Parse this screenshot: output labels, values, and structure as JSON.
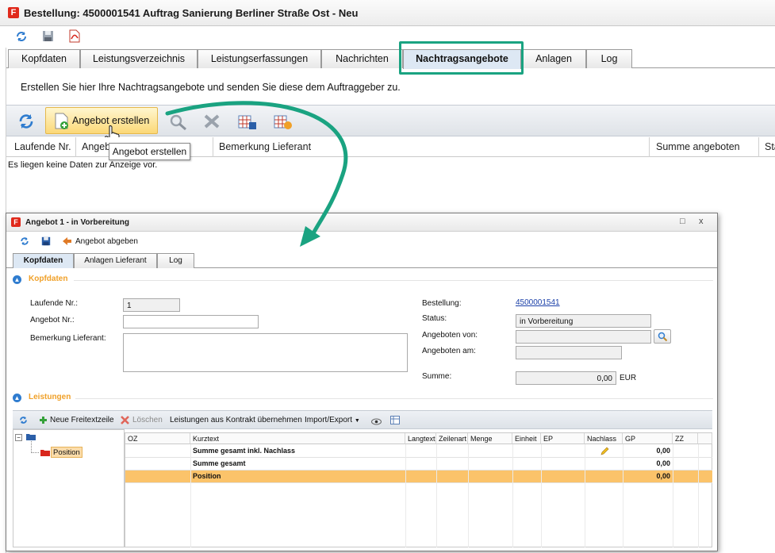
{
  "window": {
    "title": "Bestellung: 4500001541 Auftrag Sanierung Berliner Straße Ost - Neu",
    "logo_letter": "F"
  },
  "toolbar": {
    "icons": [
      "refresh-icon",
      "save-icon",
      "pdf-icon"
    ]
  },
  "tabs": [
    {
      "label": "Kopfdaten"
    },
    {
      "label": "Leistungsverzeichnis"
    },
    {
      "label": "Leistungserfassungen"
    },
    {
      "label": "Nachrichten"
    },
    {
      "label": "Nachtragsangebote",
      "active": true
    },
    {
      "label": "Anlagen"
    },
    {
      "label": "Log"
    }
  ],
  "info_text": "Erstellen Sie hier Ihre Nachtragsangebote und senden Sie diese dem Auftraggeber zu.",
  "actions": {
    "create_label": "Angebot erstellen",
    "tooltip": "Angebot erstellen"
  },
  "grid": {
    "columns": [
      "Laufende Nr.",
      "Angebot",
      "Bemerkung Lieferant",
      "Summe angeboten",
      "Sta"
    ],
    "empty_text": "Es liegen keine Daten zur Anzeige vor."
  },
  "dialog": {
    "title": "Angebot 1 - in Vorbereitung",
    "logo_letter": "F",
    "controls": {
      "minimize": "□",
      "close": "x"
    },
    "toolbar": {
      "abgeben_label": "Angebot abgeben"
    },
    "tabs": [
      {
        "label": "Kopfdaten",
        "active": true
      },
      {
        "label": "Anlagen Lieferant"
      },
      {
        "label": "Log"
      }
    ],
    "kopfdaten": {
      "section_title": "Kopfdaten",
      "laufende_nr_label": "Laufende Nr.:",
      "laufende_nr_value": "1",
      "angebot_nr_label": "Angebot Nr.:",
      "angebot_nr_value": "",
      "bemerkung_label": "Bemerkung Lieferant:",
      "bemerkung_value": "",
      "bestellung_label": "Bestellung:",
      "bestellung_value": "4500001541",
      "status_label": "Status:",
      "status_value": "in Vorbereitung",
      "angeboten_von_label": "Angeboten von:",
      "angeboten_von_value": "",
      "angeboten_am_label": "Angeboten am:",
      "angeboten_am_value": "",
      "summe_label": "Summe:",
      "summe_value": "0,00",
      "currency": "EUR"
    },
    "leistungen": {
      "section_title": "Leistungen",
      "toolbar": {
        "neue_label": "Neue Freitextzeile",
        "loeschen_label": "Löschen",
        "uebernehmen_label": "Leistungen aus Kontrakt übernehmen",
        "import_label": "Import/Export"
      },
      "tree": {
        "child_label": "Position"
      },
      "columns": [
        "OZ",
        "Kurztext",
        "Langtext",
        "Zeilenart",
        "Menge",
        "Einheit",
        "EP",
        "Nachlass",
        "GP",
        "ZZ"
      ],
      "rows": [
        {
          "kurztext": "Summe gesamt inkl. Nachlass",
          "gp": "0,00",
          "nachlass_icon": "pencil-icon"
        },
        {
          "kurztext": "Summe gesamt",
          "gp": "0,00"
        },
        {
          "kurztext": "Position",
          "gp": "0,00",
          "selected": true
        }
      ]
    }
  },
  "colors": {
    "accent_highlight": "#1aa381",
    "section_title": "#f0a028",
    "selected_row": "#fbc36a",
    "link": "#1a3fa8"
  }
}
